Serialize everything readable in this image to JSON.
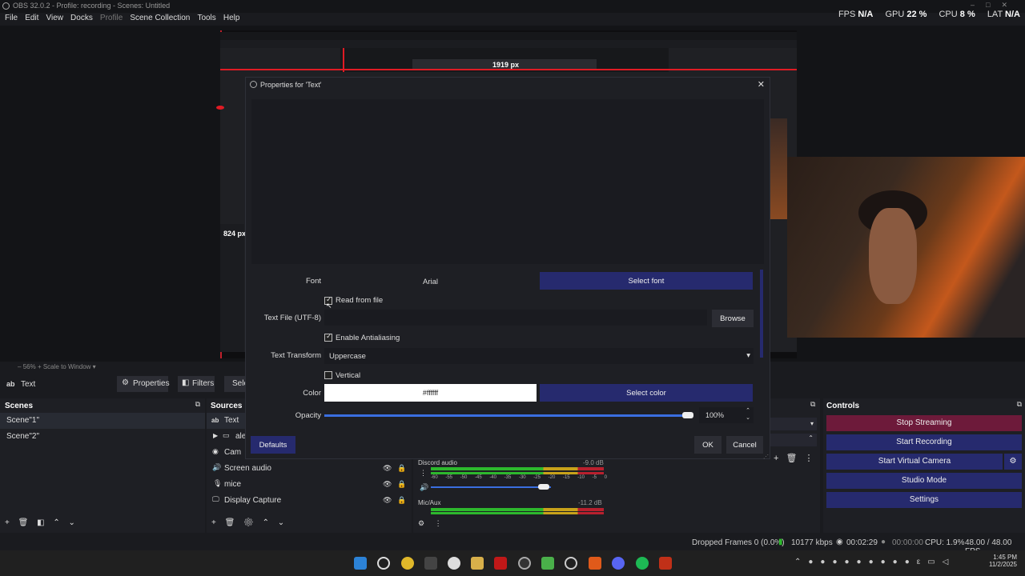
{
  "titlebar": {
    "title": "OBS 32.0.2 - Profile: recording - Scenes: Untitled"
  },
  "menu": [
    {
      "label": "File",
      "dim": false
    },
    {
      "label": "Edit",
      "dim": false
    },
    {
      "label": "View",
      "dim": false
    },
    {
      "label": "Docks",
      "dim": false
    },
    {
      "label": "Profile",
      "dim": true
    },
    {
      "label": "Scene Collection",
      "dim": false
    },
    {
      "label": "Tools",
      "dim": false
    },
    {
      "label": "Help",
      "dim": false
    }
  ],
  "stats": {
    "fps_label": "FPS",
    "fps": "N/A",
    "gpu_label": "GPU",
    "gpu": "22 %",
    "cpu_label": "CPU",
    "cpu": "8 %",
    "lat_label": "LAT",
    "lat": "N/A"
  },
  "preview": {
    "width_px": "1919 px",
    "height_px": "824 px",
    "zoom": "56%",
    "scale_mode": "Scale to Window"
  },
  "source_toolbar": {
    "source_name": "Text",
    "properties": "Properties",
    "filters": "Filters",
    "select": "Sele"
  },
  "scenes": {
    "header": "Scenes",
    "items": [
      "Scene\"1\"",
      "Scene\"2\""
    ]
  },
  "sources": {
    "header": "Sources",
    "items": [
      "Text",
      "ale",
      "Cam",
      "Screen audio",
      "mice",
      "Display Capture"
    ]
  },
  "mixer": {
    "channels": [
      {
        "name": "Discord audio",
        "level": "-9.0 dB"
      },
      {
        "name": "Mic/Aux",
        "level": "-11.2 dB"
      }
    ],
    "scale": [
      "-60",
      "-55",
      "-50",
      "-45",
      "-40",
      "-35",
      "-30",
      "-25",
      "-20",
      "-15",
      "-10",
      "-5",
      "0"
    ]
  },
  "controls": {
    "header": "Controls",
    "stop_streaming": "Stop Streaming",
    "start_recording": "Start Recording",
    "start_virtual_camera": "Start Virtual Camera",
    "studio_mode": "Studio Mode",
    "settings": "Settings"
  },
  "status": {
    "dropped": "Dropped Frames 0 (0.0%)",
    "bitrate": "10177 kbps",
    "stream_time": "00:02:29",
    "rec_time": "00:00:00",
    "cpu": "CPU: 1.9%",
    "fps": "48.00 / 48.00 FPS"
  },
  "taskbar": {
    "time": "1:45 PM",
    "date": "11/2/2025"
  },
  "dialog": {
    "title": "Properties for 'Text'",
    "font_label": "Font",
    "font_value": "Arial",
    "select_font": "Select font",
    "read_from_file": "Read from file",
    "text_file_label": "Text File (UTF-8)",
    "browse": "Browse",
    "antialias": "Enable Antialiasing",
    "transform_label": "Text Transform",
    "transform_value": "Uppercase",
    "vertical": "Vertical",
    "color_label": "Color",
    "color_value": "#ffffff",
    "select_color": "Select color",
    "opacity_label": "Opacity",
    "opacity_value": "100%",
    "opacity_fraction": 1.0,
    "defaults": "Defaults",
    "ok": "OK",
    "cancel": "Cancel"
  },
  "colors": {
    "accent": "#262a6e",
    "stop": "#6d1a3a",
    "meter_green": "#2db82d",
    "meter_yellow": "#c8a21a",
    "meter_red": "#b8202e",
    "guide_red": "#e01b24"
  }
}
